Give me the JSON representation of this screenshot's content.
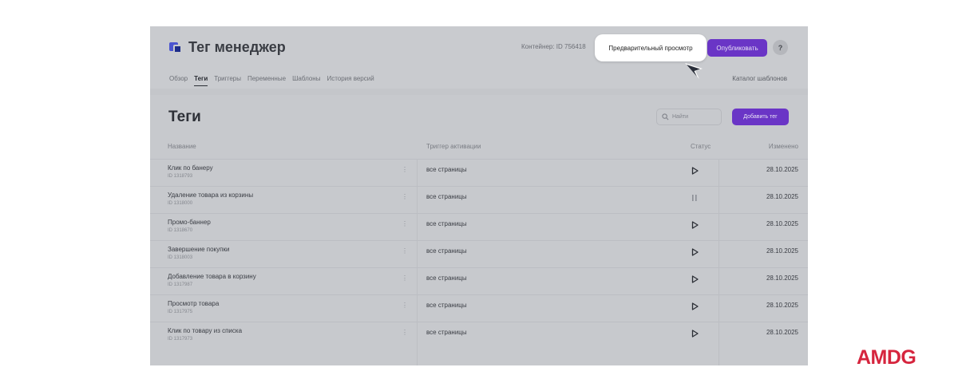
{
  "app": {
    "title": "Тег менеджер",
    "container_label": "Контейнер: ID 756418",
    "preview_label": "Предварительный просмотр",
    "publish_label": "Опубликовать",
    "help_label": "?"
  },
  "nav": {
    "tabs": [
      {
        "label": "Обзор",
        "active": false
      },
      {
        "label": "Теги",
        "active": true
      },
      {
        "label": "Триггеры",
        "active": false
      },
      {
        "label": "Переменные",
        "active": false
      },
      {
        "label": "Шаблоны",
        "active": false
      },
      {
        "label": "История версий",
        "active": false
      }
    ],
    "catalog_label": "Каталог шаблонов"
  },
  "tags_panel": {
    "title": "Теги",
    "search_placeholder": "Найти",
    "add_label": "Добавить тег",
    "columns": {
      "name": "Название",
      "trigger": "Триггер активации",
      "status": "Статус",
      "modified": "Изменено"
    },
    "rows": [
      {
        "name": "Клик по банеру",
        "id": "ID 1318793",
        "trigger": "все страницы",
        "status": "play",
        "modified": "28.10.2025"
      },
      {
        "name": "Удаление товара из корзины",
        "id": "ID 1318000",
        "trigger": "все страницы",
        "status": "pause",
        "modified": "28.10.2025"
      },
      {
        "name": "Промо-баннер",
        "id": "ID 1318670",
        "trigger": "все страницы",
        "status": "play",
        "modified": "28.10.2025"
      },
      {
        "name": "Завершение покупки",
        "id": "ID 1318003",
        "trigger": "все страницы",
        "status": "play",
        "modified": "28.10.2025"
      },
      {
        "name": "Добавление товара в корзину",
        "id": "ID 1317987",
        "trigger": "все страницы",
        "status": "play",
        "modified": "28.10.2025"
      },
      {
        "name": "Просмотр товара",
        "id": "ID 1317975",
        "trigger": "все страницы",
        "status": "play",
        "modified": "28.10.2025"
      },
      {
        "name": "Клик по товару из списка",
        "id": "ID 1317973",
        "trigger": "все страницы",
        "status": "play",
        "modified": "28.10.2025"
      }
    ]
  },
  "brand": {
    "label": "AMDG",
    "color": "#d6253e"
  },
  "colors": {
    "accent": "#6a35c6"
  }
}
